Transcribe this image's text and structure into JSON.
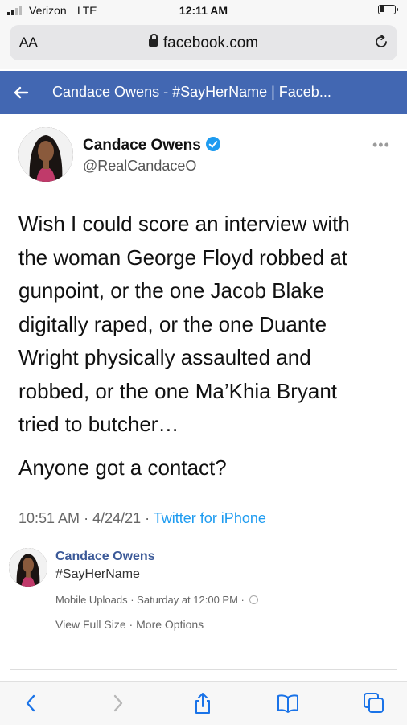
{
  "status_bar": {
    "carrier": "Verizon",
    "network": "LTE",
    "time": "12:11 AM",
    "battery_level": 0.35
  },
  "address_bar": {
    "text_size_label": "AA",
    "domain": "facebook.com",
    "lock_icon": "lock-icon",
    "reload_icon": "reload-icon"
  },
  "fb_header": {
    "back_icon": "back-arrow-icon",
    "title": "Candace Owens - #SayHerName | Faceb..."
  },
  "tweet": {
    "author": "Candace Owens",
    "verified": true,
    "handle": "@RealCandaceO",
    "more_icon": "more-icon",
    "more_glyph": "•••",
    "text_lines": [
      "Wish I could score an interview with",
      "the woman George Floyd robbed at",
      "gunpoint, or the one Jacob Blake",
      "digitally raped, or the one Duante",
      "Wright physically assaulted and",
      "robbed, or the one Ma’Khia Bryant",
      "tried to butcher…"
    ],
    "question": "Anyone got a contact?",
    "time": "10:51 AM",
    "date": "4/24/21",
    "source": "Twitter for iPhone"
  },
  "post": {
    "page_name": "Candace Owens",
    "hashtag": "#SayHerName",
    "album": "Mobile Uploads",
    "posted": "Saturday at 12:00 PM",
    "view_full_size": "View Full Size",
    "more_options": "More Options"
  },
  "toolbar": {
    "icons": [
      "back-icon",
      "forward-icon",
      "share-icon",
      "bookmarks-icon",
      "tabs-icon"
    ]
  },
  "colors": {
    "facebook_blue": "#4267b2",
    "link_blue": "#1d9bf0",
    "ios_blue": "#1a73e8"
  }
}
